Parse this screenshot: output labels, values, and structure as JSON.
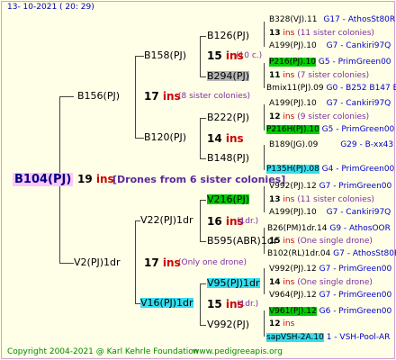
{
  "date": "13- 10-2021 ( 20: 29)",
  "root": "B104(PJ)",
  "root_num": "19",
  "root_ins": "ins",
  "root_note": "[Drones from 6 sister colonies]",
  "n_b156": "B156(PJ)",
  "n_b156_num": "17",
  "n_b156_ins": "ins",
  "n_b156_note": "(8 sister colonies)",
  "n_b158": "B158(PJ)",
  "n_b158_num": "15",
  "n_b158_ins": "ins",
  "n_b158_note": "(10 c.)",
  "n_b126": "B126(PJ)",
  "n_b294": "B294(PJ)",
  "n_b120": "B120(PJ)",
  "n_b120_num": "14",
  "n_b120_ins": "ins",
  "n_b222": "B222(PJ)",
  "n_b148": "B148(PJ)",
  "n_v2": "V2(PJ)1dr",
  "n_v2_num": "17",
  "n_v2_ins": "ins",
  "n_v2_note": "(Only one drone)",
  "n_v22": "V22(PJ)1dr",
  "n_v22_num": "16",
  "n_v22_ins": "ins",
  "n_v22_note": "(1dr.)",
  "n_v216": "V216(PJ)",
  "n_b595": "B595(ABR)1dr",
  "n_v16": "V16(PJ)1dr",
  "n_v16_num": "15",
  "n_v16_ins": "ins",
  "n_v16_note": "(1dr.)",
  "n_v95": "V95(PJ)1dr",
  "n_v992": "V992(PJ)",
  "leaves": [
    {
      "a": "B328(VJ).11",
      "b": "G17 - AthosSt80R"
    },
    {
      "num": "13",
      "ins": "ins",
      "note": "(11 sister colonies)"
    },
    {
      "a": "A199(PJ).10",
      "b": "G7 - Cankiri97Q"
    },
    {
      "a": "P216(PJ).10",
      "b": "G5 - PrimGreen00"
    },
    {
      "num": "11",
      "ins": "ins",
      "note": "(7 sister colonies)"
    },
    {
      "a": "Bmix11(PJ).09",
      "b": "G0 - B252 B147 B"
    },
    {
      "a": "A199(PJ).10",
      "b": "G7 - Cankiri97Q"
    },
    {
      "num": "12",
      "ins": "ins",
      "note": "(9 sister colonies)"
    },
    {
      "a": "P216H(PJ).10",
      "b": "G5 - PrimGreen00"
    },
    {
      "a": "B189(JG).09",
      "b": "G29 - B-xx43"
    },
    {
      "a": "P135H(PJ).08",
      "b": "G4 - PrimGreen00"
    },
    {
      "a": "V992(PJ).12",
      "b": "G7 - PrimGreen00"
    },
    {
      "num": "13",
      "ins": "ins",
      "note": "(11 sister colonies)"
    },
    {
      "a": "A199(PJ).10",
      "b": "G7 - Cankiri97Q"
    },
    {
      "a": "B26(PM)1dr.14",
      "b": "G9 - AthosOOR"
    },
    {
      "num": "15",
      "ins": "ins",
      "note": "(One single drone)"
    },
    {
      "a": "B102(RL)1dr.04",
      "b": "G7 - AthosSt80R"
    },
    {
      "a": "V992(PJ).12",
      "b": "G7 - PrimGreen00"
    },
    {
      "num": "14",
      "ins": "ins",
      "note": "(One single drone)"
    },
    {
      "a": "V964(PJ).12",
      "b": "G7 - PrimGreen00"
    },
    {
      "a": "V961(PJ).12",
      "b": "G6 - PrimGreen00"
    },
    {
      "num": "12",
      "ins": "ins",
      "note": ""
    },
    {
      "a": "sapVSH-2A.10",
      "b": "1 - VSH-Pool-AR"
    }
  ],
  "footer_copy": "Copyright 2004-2021 @ Karl Kehrle Foundation",
  "footer_url": "www.pedigreeapis.org"
}
